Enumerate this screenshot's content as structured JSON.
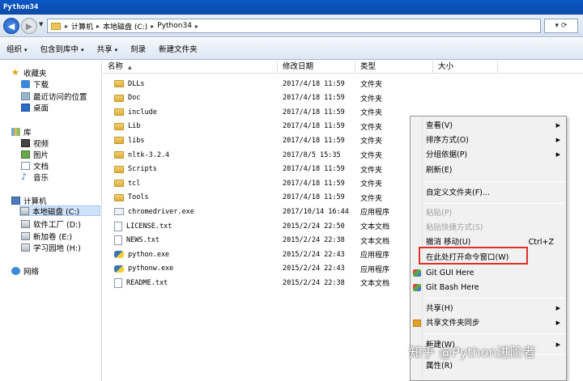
{
  "window": {
    "title": "Python34"
  },
  "address": {
    "segments": [
      "计算机",
      "本地磁盘 (C:)",
      "Python34"
    ],
    "separator": "▸",
    "end_label": "▾ ⟳"
  },
  "toolbar": {
    "items": [
      {
        "label": "组织",
        "arrow": "▾"
      },
      {
        "label": "包含到库中",
        "arrow": "▾"
      },
      {
        "label": "共享",
        "arrow": "▾"
      },
      {
        "label": "刻录",
        "arrow": ""
      },
      {
        "label": "新建文件夹",
        "arrow": ""
      }
    ]
  },
  "nav": {
    "favorites": "收藏夹",
    "downloads": "下载",
    "recent": "最近访问的位置",
    "desktop": "桌面",
    "libraries": "库",
    "videos": "视频",
    "pictures": "图片",
    "documents": "文档",
    "music": "音乐",
    "computer": "计算机",
    "drives": [
      "本地磁盘 (C:)",
      "软件工厂 (D:)",
      "新加卷 (E:)",
      "学习园地 (H:)"
    ],
    "network": "网络"
  },
  "columns": {
    "name": "名称",
    "date": "修改日期",
    "type": "类型",
    "size": "大小",
    "sort_glyph": "▲"
  },
  "files": [
    {
      "name": "DLLs",
      "date": "2017/4/18 11:59",
      "type": "文件夹",
      "icon": "folder"
    },
    {
      "name": "Doc",
      "date": "2017/4/18 11:59",
      "type": "文件夹",
      "icon": "folder"
    },
    {
      "name": "include",
      "date": "2017/4/18 11:59",
      "type": "文件夹",
      "icon": "folder"
    },
    {
      "name": "Lib",
      "date": "2017/4/18 11:59",
      "type": "文件夹",
      "icon": "folder"
    },
    {
      "name": "libs",
      "date": "2017/4/18 11:59",
      "type": "文件夹",
      "icon": "folder"
    },
    {
      "name": "nltk-3.2.4",
      "date": "2017/8/5 15:35",
      "type": "文件夹",
      "icon": "folder"
    },
    {
      "name": "Scripts",
      "date": "2017/4/18 11:59",
      "type": "文件夹",
      "icon": "folder"
    },
    {
      "name": "tcl",
      "date": "2017/4/18 11:59",
      "type": "文件夹",
      "icon": "folder"
    },
    {
      "name": "Tools",
      "date": "2017/4/18 11:59",
      "type": "文件夹",
      "icon": "folder"
    },
    {
      "name": "chromedriver.exe",
      "date": "2017/10/14 16:44",
      "type": "应用程序",
      "icon": "exe"
    },
    {
      "name": "LICENSE.txt",
      "date": "2015/2/24 22:50",
      "type": "文本文档",
      "icon": "txt"
    },
    {
      "name": "NEWS.txt",
      "date": "2015/2/24 22:38",
      "type": "文本文档",
      "icon": "txt"
    },
    {
      "name": "python.exe",
      "date": "2015/2/24 22:43",
      "type": "应用程序",
      "icon": "py"
    },
    {
      "name": "pythonw.exe",
      "date": "2015/2/24 22:43",
      "type": "应用程序",
      "icon": "py"
    },
    {
      "name": "README.txt",
      "date": "2015/2/24 22:38",
      "type": "文本文档",
      "icon": "txt"
    }
  ],
  "context_menu": {
    "view": "查看(V)",
    "sort": "排序方式(O)",
    "group": "分组依据(P)",
    "refresh": "刷新(E)",
    "customize": "自定义文件夹(F)...",
    "paste": "粘贴(P)",
    "paste_shortcut": "粘贴快捷方式(S)",
    "undo_move": "撤消 移动(U)",
    "undo_shortcut": "Ctrl+Z",
    "open_cmd": "在此处打开命令窗口(W)",
    "git_gui": "Git GUI Here",
    "git_bash": "Git Bash Here",
    "share": "共享(H)",
    "share_sync": "共享文件夹同步",
    "new": "新建(W)",
    "properties": "属性(R)",
    "submenu_glyph": "▶"
  },
  "watermark": "知乎 @Python进阶者",
  "colors": {
    "highlight_box": "#e0302a",
    "title_bar": "#0c4aa6",
    "selection": "#cfe3fb"
  }
}
